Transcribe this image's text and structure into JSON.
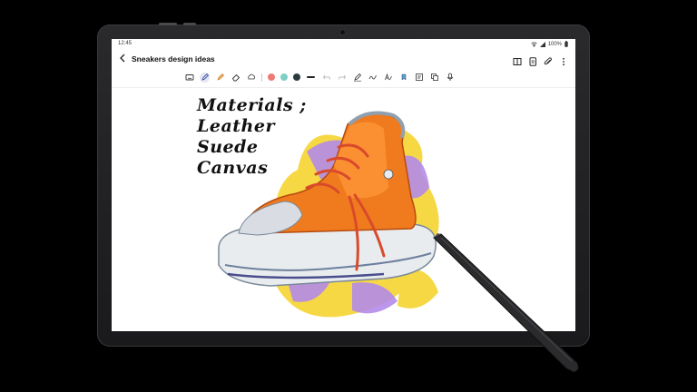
{
  "status": {
    "time": "12:45",
    "battery": "100%"
  },
  "note": {
    "title": "Sneakers design ideas"
  },
  "toolbar": {
    "swatches": [
      "#ef7a74",
      "#7ecfc4",
      "#2b3a3e"
    ],
    "active_tool": "pen"
  },
  "handwriting": {
    "line1": "Materials ;",
    "line2": "Leather",
    "line3": "Suede",
    "line4": "Canvas"
  },
  "colors": {
    "shoe_orange": "#f07b1e",
    "paint_yellow": "#f6d63a",
    "paint_purple": "#b48be8",
    "sole_white": "#e9ecef"
  }
}
